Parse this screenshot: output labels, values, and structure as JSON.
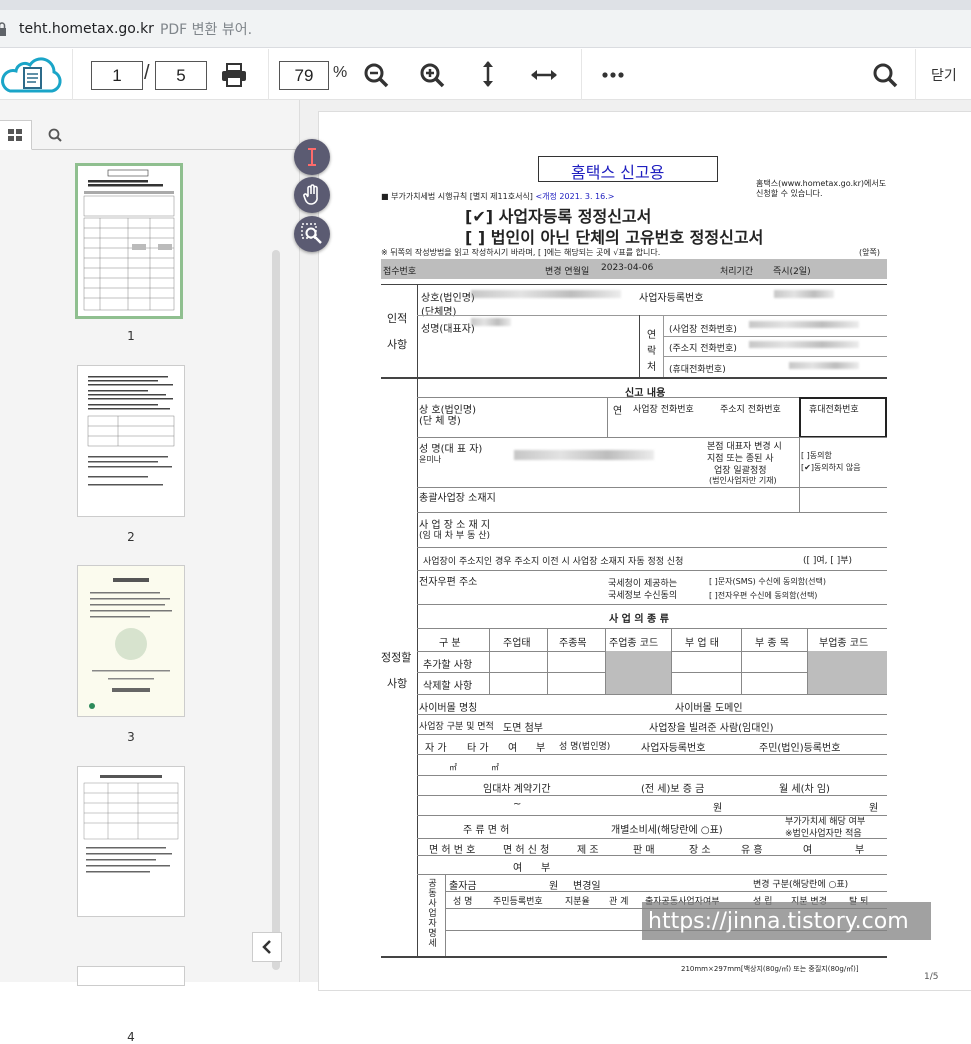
{
  "browser": {
    "domain": "teht.hometax.go.kr",
    "title": "PDF 변환 뷰어."
  },
  "toolbar": {
    "current_page": "1",
    "slash": "/",
    "total_pages": "5",
    "zoom": "79",
    "zoom_unit": "%",
    "close_label": "닫기"
  },
  "sidebar": {
    "thumbs": [
      {
        "label": "1"
      },
      {
        "label": "2"
      },
      {
        "label": "3"
      },
      {
        "label": "4"
      }
    ]
  },
  "document": {
    "header_box": "홈택스 신고용",
    "hometax_note1": "홈택스(www.hometax.go.kr)에서도",
    "hometax_note2": "신청할 수 있습니다.",
    "rule_ref": "■ 부가가치세법 시행규칙 [별지 제11호서식] ",
    "rule_ref_rev": "<개정 2021. 3. 16.>",
    "title1": "[✔] 사업자등록 정정신고서",
    "title2": "[  ] 법인이 아닌 단체의 고유번호 정정신고서",
    "notice": "※ 뒤쪽의 작성방법을 읽고 작성하시기 바라며, [  ]에는 해당되는 곳에 √표를 합니다.",
    "side_label": "(앞쪽)",
    "receipt_no": "접수번호",
    "change_date_label": "변경 연월일",
    "change_date": "2023-04-06",
    "process_period_label": "처리기간",
    "process_period": "즉시(2일)",
    "personal": "인적",
    "matters": "사항",
    "company_name": "상호(법인명)",
    "org_name": "(단체명)",
    "biz_reg_no": "사업자등록번호",
    "rep_name": "성명(대표자)",
    "contact1": "연",
    "contact2": "락",
    "contact3": "처",
    "office_phone": "(사업장 전화번호)",
    "home_phone": "(주소지 전화번호)",
    "mobile_phone": "(휴대전화번호)",
    "report_content": "신고 내용",
    "r_company": "상 호(법인명)",
    "r_org": "(단 체 명)",
    "r_contact": "연",
    "r_office_phone": "사업장 전화번호",
    "r_home_phone": "주소지 전화번호",
    "r_mobile_phone": "휴대전화번호",
    "r_rep": "성 명(대 표 자)",
    "r_rep_sub": "윤미나",
    "r_branch1": "본점 대표자 변경 시",
    "r_branch2": "지점 또는 종된 사",
    "r_branch3": "업장 일괄정정",
    "r_branch4": "(법인사업자만 기재)",
    "r_agree": "[  ]동의함",
    "r_disagree": "[✔]동의하지 않음",
    "r_hq": "총괄사업장 소재지",
    "r_biz_loc": "사 업 장  소 재 지",
    "r_lease": "(임 대 차 부 동 산)",
    "r_auto": "사업장이 주소지인 경우 주소지 이전 시 사업장 소재지 자동 정정 신청",
    "r_auto_yn": "([  ]여, [  ]부)",
    "r_epost": "전자우편 주소",
    "r_nts1": "국세청이 제공하는",
    "r_nts2": "국세정보 수신동의",
    "r_sms": "[  ]문자(SMS) 수신에 동의함(선택)",
    "r_email": "[  ]전자우편 수신에 동의함(선택)",
    "correct1": "정정할",
    "correct2": "사항",
    "biz_type_title": "사 업 의  종 류",
    "bt_cols": [
      "구 분",
      "주업태",
      "주종목",
      "주업종 코드",
      "부 업 태",
      "부 종 목",
      "부업종 코드"
    ],
    "bt_add": "추가할 사항",
    "bt_del": "삭제할 사항",
    "cyber_name": "사이버몰 명칭",
    "cyber_domain": "사이버몰 도메인",
    "area_row": "사업장 구분 및 면적",
    "drawing": "도면 첨부",
    "lessor": "사업장을 빌려준 사람(임대인)",
    "own": "자 가",
    "other": "타 가",
    "yes": "여",
    "no": "부",
    "l_name": "성 명(법인명)",
    "l_biz": "사업자등록번호",
    "l_resident": "주민(법인)등록번호",
    "sqm1": "㎡",
    "sqm2": "㎡",
    "lease_period": "임대차 계약기간",
    "deposit": "(전 세)보 증 금",
    "monthly": "월 세(차 임)",
    "tilde": "~",
    "won1": "원",
    "won2": "원",
    "liquor": "주 류 면 허",
    "excise": "개별소비세(해당란에 ○표)",
    "vat1": "부가가치세 해당 여부",
    "vat2": "※법인사업자만 적음",
    "lic_no": "면 허 번 호",
    "lic_apply": "면 허 신 청",
    "mfg": "제 조",
    "sale": "판 매",
    "place": "장 소",
    "ent": "유 흥",
    "y2": "여",
    "n2": "부",
    "y3": "여",
    "n3": "부",
    "joint": "공동사업자명세",
    "invest": "출자금",
    "won3": "원",
    "change_day": "변경일",
    "change_type": "변경 구분(해당란에 ○표)",
    "j_cols": [
      "성 명",
      "주민등록번호",
      "지분율",
      "관 계",
      "출자공동사업자여부",
      "성 립",
      "지분 변경",
      "탈 퇴"
    ],
    "footer_paper": "210mm×297mm[백상지(80g/㎡) 또는 중질지(80g/㎡)]",
    "page_num": "1/5"
  },
  "watermark": "https://jinna.tistory.com"
}
